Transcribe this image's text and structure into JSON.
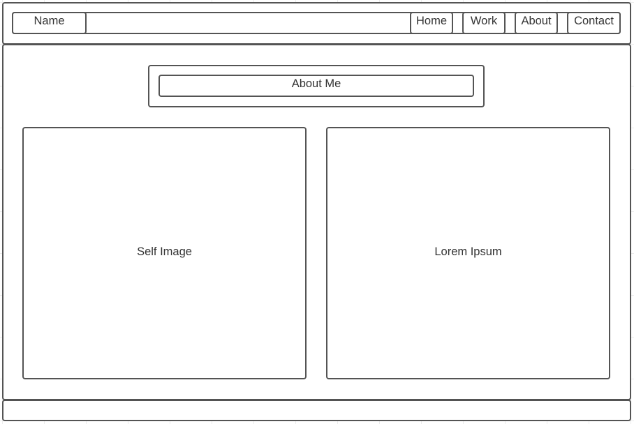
{
  "header": {
    "name_label": "Name",
    "nav": {
      "home": "Home",
      "work": "Work",
      "about": "About",
      "contact": "Contact"
    }
  },
  "main": {
    "heading": "About Me",
    "left_panel": "Self Image",
    "right_panel": "Lorem Ipsum"
  },
  "footer": {}
}
